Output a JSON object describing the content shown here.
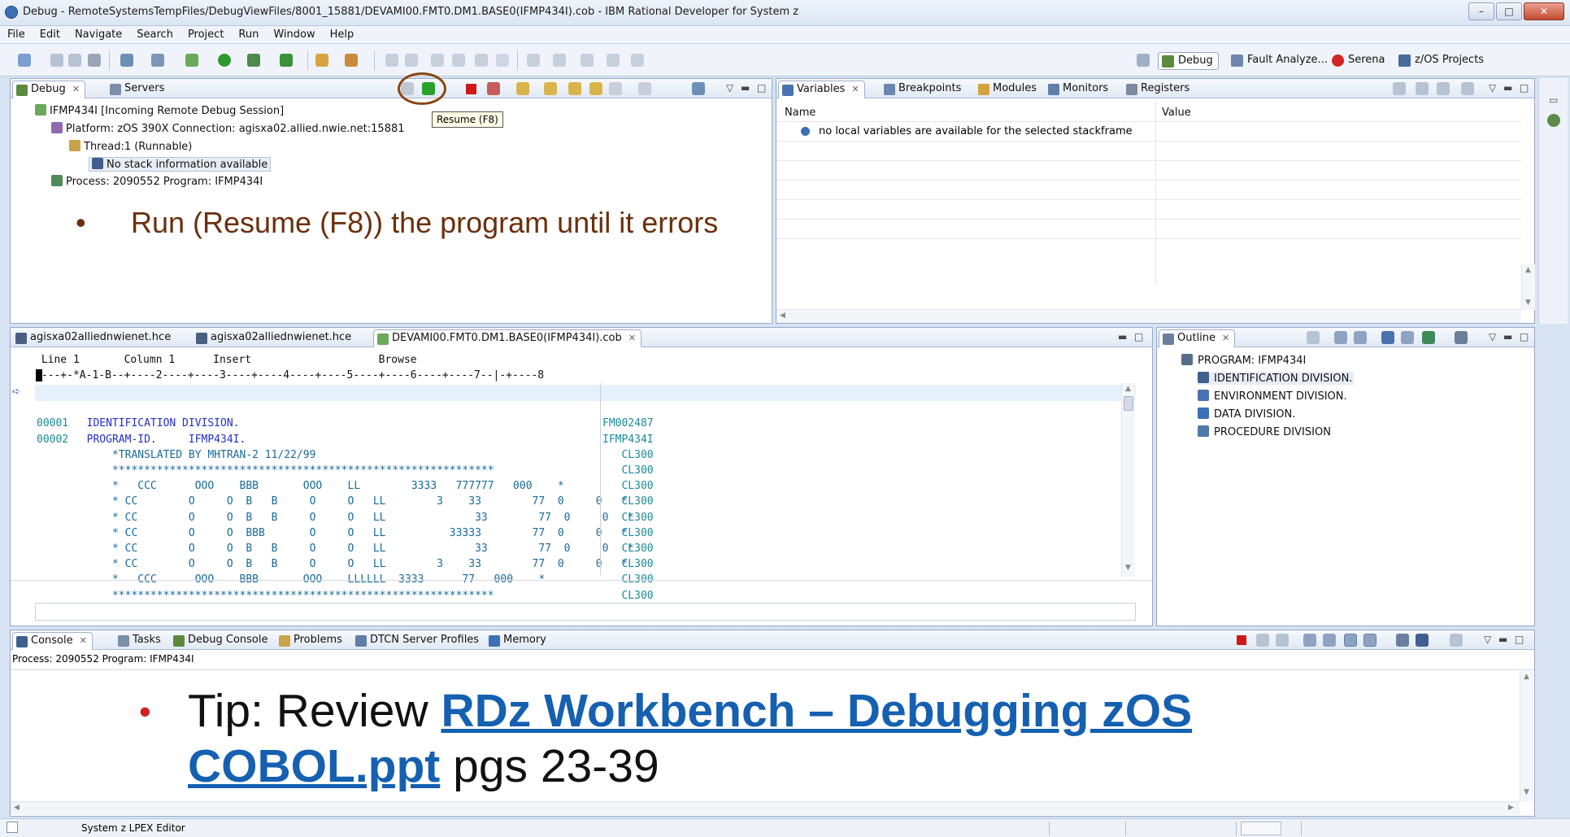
{
  "window": {
    "title": "Debug - RemoteSystemsTempFiles/DebugViewFiles/8001_15881/DEVAMI00.FMT0.DM1.BASE0(IFMP434I).cob - IBM Rational Developer for System z",
    "minimize": "–",
    "maximize": "□",
    "close": "✕"
  },
  "menu": [
    "File",
    "Edit",
    "Navigate",
    "Search",
    "Project",
    "Run",
    "Window",
    "Help"
  ],
  "perspectives": [
    {
      "label": "Debug",
      "icon": "debug-perspective-icon",
      "active": true
    },
    {
      "label": "Fault Analyze...",
      "icon": "fault-analyzer-icon"
    },
    {
      "label": "Serena",
      "icon": "serena-icon"
    },
    {
      "label": "z/OS Projects",
      "icon": "zos-projects-icon"
    }
  ],
  "debug_view": {
    "tabs": [
      {
        "label": "Debug",
        "active": true
      },
      {
        "label": "Servers"
      }
    ],
    "tooltip": "Resume (F8)",
    "tree": [
      {
        "text": "IFMP434I [Incoming Remote Debug Session]",
        "icon": "remote-debug-icon"
      },
      {
        "text": "Platform: zOS 390X    Connection: agisxa02.allied.nwie.net:15881",
        "icon": "platform-icon"
      },
      {
        "text": "Thread:1 (Runnable)",
        "icon": "thread-icon"
      },
      {
        "text": "No stack information available",
        "icon": "stack-icon"
      },
      {
        "text": "Process: 2090552   Program: IFMP434I",
        "icon": "process-icon"
      }
    ],
    "annotation": "Run (Resume (F8)) the program until it errors",
    "bullet": "•"
  },
  "variables_view": {
    "tabs": [
      {
        "label": "Variables",
        "active": true
      },
      {
        "label": "Breakpoints"
      },
      {
        "label": "Modules"
      },
      {
        "label": "Monitors"
      },
      {
        "label": "Registers"
      }
    ],
    "columns": [
      "Name",
      "Value"
    ],
    "message": "no local variables are available for the selected stackframe"
  },
  "editor": {
    "tabs": [
      {
        "label": "agisxa02alliednwienet.hce"
      },
      {
        "label": "agisxa02alliednwienet.hce"
      },
      {
        "label": "DEVAMI00.FMT0.DM1.BASE0(IFMP434I).cob",
        "active": true
      }
    ],
    "status_line": " Line 1       Column 1      Insert                    Browse",
    "ruler": "----+-*A-1-B--+----2----+----3----+----4----+----5----+----6----+----7--|-+----8",
    "lines": [
      {
        "num": "00001",
        "text": "  IDENTIFICATION DIVISION.",
        "seq": "FM002487"
      },
      {
        "num": "00002",
        "text": "  PROGRAM-ID.     IFMP434I.",
        "seq": "IFMP434I"
      },
      {
        "num": "",
        "text": "      *TRANSLATED BY MHTRAN-2 11/22/99",
        "seq": "   CL300"
      },
      {
        "num": "",
        "text": "      ************************************************************",
        "seq": "   CL300"
      },
      {
        "num": "",
        "text": "      *   CCC      OOO    BBB       OOO    LL        3333   777777   000    *",
        "seq": "   CL300"
      },
      {
        "num": "",
        "text": "      * CC        O     O  B   B     O     O   LL        3    33        77  0     0   *",
        "seq": "   CL300"
      },
      {
        "num": "",
        "text": "      * CC        O     O  B   B     O     O   LL              33        77  0     0   *",
        "seq": "   CL300"
      },
      {
        "num": "",
        "text": "      * CC        O     O  BBB       O     O   LL          33333        77  0     0   *",
        "seq": "   CL300"
      },
      {
        "num": "",
        "text": "      * CC        O     O  B   B     O     O   LL              33        77  0     0   *",
        "seq": "   CL300"
      },
      {
        "num": "",
        "text": "      * CC        O     O  B   B     O     O   LL        3    33        77  0     0   *",
        "seq": "   CL300"
      },
      {
        "num": "",
        "text": "      *   CCC      OOO    BBB       OOO    LLLLLL  3333      77   000    *",
        "seq": "   CL300"
      },
      {
        "num": "",
        "text": "      ************************************************************",
        "seq": "   CL300"
      }
    ]
  },
  "outline_view": {
    "tab": "Outline",
    "items": [
      {
        "text": "PROGRAM: IFMP434I",
        "icon": "program-icon",
        "level": 0
      },
      {
        "text": "IDENTIFICATION DIVISION.",
        "icon": "identification-icon",
        "level": 1
      },
      {
        "text": "ENVIRONMENT DIVISION.",
        "icon": "environment-icon",
        "level": 1
      },
      {
        "text": "DATA DIVISION.",
        "icon": "data-icon",
        "level": 1
      },
      {
        "text": "PROCEDURE DIVISION",
        "icon": "procedure-icon",
        "level": 1
      }
    ]
  },
  "console_view": {
    "tabs": [
      {
        "label": "Console",
        "active": true
      },
      {
        "label": "Tasks"
      },
      {
        "label": "Debug Console"
      },
      {
        "label": "Problems"
      },
      {
        "label": "DTCN Server Profiles"
      },
      {
        "label": "Memory"
      }
    ],
    "process_line": "Process: 2090552   Program: IFMP434I",
    "tip_bullet": "•",
    "tip_prefix": "Tip:  Review ",
    "tip_link_1": "RDz Workbench – Debugging zOS",
    "tip_link_2": "COBOL.ppt",
    "tip_suffix": " pgs 23-39"
  },
  "status_bar": {
    "text": "System z LPEX Editor"
  },
  "colors": {
    "accent": "#1560b0",
    "annotation": "#6b2f0d",
    "highlight_circle": "#8b4513",
    "resume_green": "#2aa02a",
    "terminate_red": "#d01818"
  }
}
